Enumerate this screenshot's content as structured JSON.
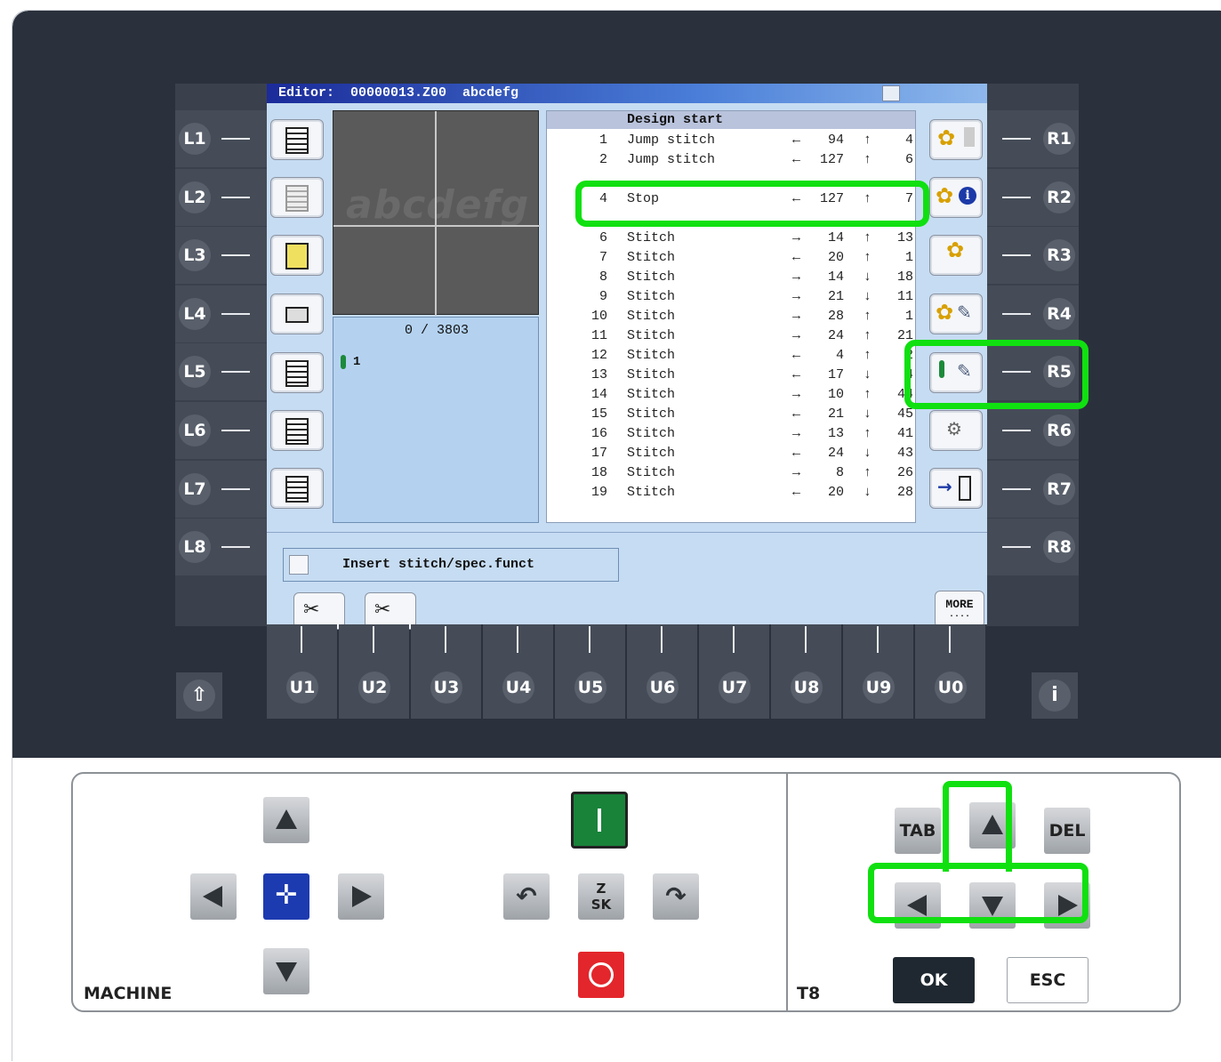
{
  "title_bar": {
    "text": "Editor:  00000013.Z00  abcdefg"
  },
  "left_buttons": [
    "L1",
    "L2",
    "L3",
    "L4",
    "L5",
    "L6",
    "L7",
    "L8"
  ],
  "right_buttons": [
    "R1",
    "R2",
    "R3",
    "R4",
    "R5",
    "R6",
    "R7",
    "R8"
  ],
  "bottom_buttons": [
    "U1",
    "U2",
    "U3",
    "U4",
    "U5",
    "U6",
    "U7",
    "U8",
    "U9",
    "U0"
  ],
  "preview": {
    "ghost_text": "abcdefg"
  },
  "info": {
    "counter": "0 / 3803",
    "needle": "1"
  },
  "list": {
    "header": "Design start",
    "rows": [
      {
        "num": "1",
        "type": "Jump stitch",
        "xd": "←",
        "xv": "94",
        "yd": "↑",
        "yv": "4"
      },
      {
        "num": "2",
        "type": "Jump stitch",
        "xd": "←",
        "xv": "127",
        "yd": "↑",
        "yv": "6"
      },
      {
        "num": "4",
        "type": "Stop",
        "xd": "←",
        "xv": "127",
        "yd": "↑",
        "yv": "7"
      },
      {
        "num": "6",
        "type": "Stitch",
        "xd": "→",
        "xv": "14",
        "yd": "↑",
        "yv": "13"
      },
      {
        "num": "7",
        "type": "Stitch",
        "xd": "←",
        "xv": "20",
        "yd": "↑",
        "yv": "1"
      },
      {
        "num": "8",
        "type": "Stitch",
        "xd": "→",
        "xv": "14",
        "yd": "↓",
        "yv": "18"
      },
      {
        "num": "9",
        "type": "Stitch",
        "xd": "→",
        "xv": "21",
        "yd": "↓",
        "yv": "11"
      },
      {
        "num": "10",
        "type": "Stitch",
        "xd": "→",
        "xv": "28",
        "yd": "↑",
        "yv": "1"
      },
      {
        "num": "11",
        "type": "Stitch",
        "xd": "→",
        "xv": "24",
        "yd": "↑",
        "yv": "21"
      },
      {
        "num": "12",
        "type": "Stitch",
        "xd": "←",
        "xv": "4",
        "yd": "↑",
        "yv": "2"
      },
      {
        "num": "13",
        "type": "Stitch",
        "xd": "←",
        "xv": "17",
        "yd": "↓",
        "yv": "4"
      },
      {
        "num": "14",
        "type": "Stitch",
        "xd": "→",
        "xv": "10",
        "yd": "↑",
        "yv": "44"
      },
      {
        "num": "15",
        "type": "Stitch",
        "xd": "←",
        "xv": "21",
        "yd": "↓",
        "yv": "45"
      },
      {
        "num": "16",
        "type": "Stitch",
        "xd": "→",
        "xv": "13",
        "yd": "↑",
        "yv": "41"
      },
      {
        "num": "17",
        "type": "Stitch",
        "xd": "←",
        "xv": "24",
        "yd": "↓",
        "yv": "43"
      },
      {
        "num": "18",
        "type": "Stitch",
        "xd": "→",
        "xv": "8",
        "yd": "↑",
        "yv": "26"
      },
      {
        "num": "19",
        "type": "Stitch",
        "xd": "←",
        "xv": "20",
        "yd": "↓",
        "yv": "28"
      }
    ]
  },
  "status": {
    "text": "Insert stitch/spec.funct"
  },
  "more_button": {
    "line1": "MORE",
    "line2": "...."
  },
  "machine_panel": {
    "label": "MACHINE",
    "zsk_top": "Z",
    "zsk_bottom": "SK"
  },
  "t8_panel": {
    "label": "T8",
    "tab": "TAB",
    "del": "DEL",
    "ok": "OK",
    "esc": "ESC"
  },
  "shift_icon": "⇧",
  "info_icon": "i",
  "colors": {
    "highlight": "#10e010",
    "title_start": "#1b2b9a",
    "screen_bg": "#c6dcf2"
  }
}
